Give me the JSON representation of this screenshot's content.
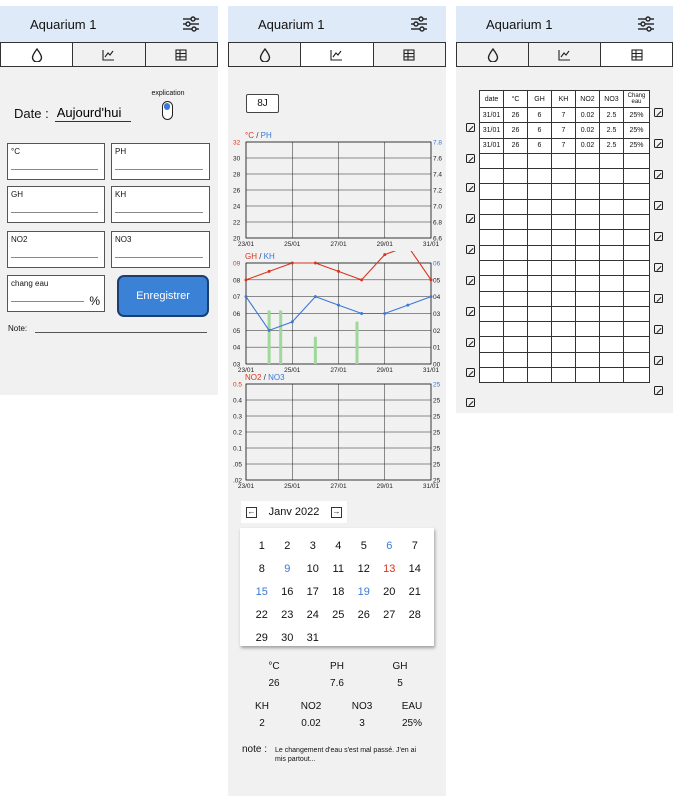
{
  "app": {
    "title": "Aquarium 1"
  },
  "screen1": {
    "date_label": "Date :",
    "date_value": "Aujourd'hui",
    "explication_label": "explication",
    "fields": [
      {
        "label": "°C"
      },
      {
        "label": "PH"
      },
      {
        "label": "GH"
      },
      {
        "label": "KH"
      },
      {
        "label": "NO2"
      },
      {
        "label": "NO3"
      }
    ],
    "water_change_label": "chang eau",
    "water_change_unit": "%",
    "save_label": "Enregistrer",
    "note_label": "Note:"
  },
  "screen2": {
    "range_label": "8J",
    "chart_data": [
      {
        "type": "line",
        "title_left": "°C",
        "title_sep": " / ",
        "title_right": "PH",
        "x": [
          "23/01",
          "25/01",
          "27/01",
          "29/01",
          "31/01"
        ],
        "y_left_ticks": [
          "32",
          "30",
          "28",
          "26",
          "24",
          "22",
          "20"
        ],
        "y_right_ticks": [
          "7.8",
          "7.6",
          "7.4",
          "7.2",
          "7.0",
          "6.8",
          "6.6"
        ],
        "series": []
      },
      {
        "type": "line",
        "title_left": "GH",
        "title_sep": " / ",
        "title_right": "KH",
        "x": [
          "23/01",
          "25/01",
          "27/01",
          "29/01",
          "31/01"
        ],
        "y_left_ticks": [
          "09",
          "08",
          "07",
          "06",
          "05",
          "04",
          "03"
        ],
        "y_right_ticks": [
          "06",
          "05",
          "04",
          "03",
          "02",
          "01",
          "00"
        ],
        "series": [
          {
            "color": "#d9341e",
            "axis": "left",
            "values": [
              5,
              5.5,
              6,
              6,
              5.5,
              5,
              6.5,
              7,
              5
            ]
          },
          {
            "color": "#3b78d8",
            "axis": "right",
            "values": [
              4,
              2,
              2.5,
              4,
              3.5,
              3,
              3,
              3.5,
              4
            ]
          }
        ],
        "bars": [
          {
            "color": "#9fd89a",
            "index": 1,
            "level": 0.53
          },
          {
            "color": "#9fd89a",
            "index": 1.5,
            "level": 0.53
          },
          {
            "color": "#9fd89a",
            "index": 3,
            "level": 0.27
          },
          {
            "color": "#9fd89a",
            "index": 4.8,
            "level": 0.42
          }
        ]
      },
      {
        "type": "line",
        "title_left": "NO2",
        "title_sep": " / ",
        "title_right": "NO3",
        "x": [
          "23/01",
          "25/01",
          "27/01",
          "29/01",
          "31/01"
        ],
        "y_left_ticks": [
          "0.5",
          "0.4",
          "0.3",
          "0.2",
          "0.1",
          ".05",
          ".02"
        ],
        "y_right_ticks": [
          "25",
          "25",
          "25",
          "25",
          "25",
          "25",
          "25"
        ],
        "series": []
      }
    ],
    "calendar": {
      "month_label": "Janv 2022",
      "prev": "←",
      "next": "→",
      "days": [
        {
          "d": "1",
          "c": ""
        },
        {
          "d": "2",
          "c": ""
        },
        {
          "d": "3",
          "c": ""
        },
        {
          "d": "4",
          "c": ""
        },
        {
          "d": "5",
          "c": ""
        },
        {
          "d": "6",
          "c": "blue"
        },
        {
          "d": "7",
          "c": ""
        },
        {
          "d": "8",
          "c": ""
        },
        {
          "d": "9",
          "c": "blue"
        },
        {
          "d": "10",
          "c": ""
        },
        {
          "d": "11",
          "c": ""
        },
        {
          "d": "12",
          "c": ""
        },
        {
          "d": "13",
          "c": "red"
        },
        {
          "d": "14",
          "c": ""
        },
        {
          "d": "15",
          "c": "blue"
        },
        {
          "d": "16",
          "c": ""
        },
        {
          "d": "17",
          "c": ""
        },
        {
          "d": "18",
          "c": ""
        },
        {
          "d": "19",
          "c": "blue"
        },
        {
          "d": "20",
          "c": ""
        },
        {
          "d": "21",
          "c": ""
        },
        {
          "d": "22",
          "c": ""
        },
        {
          "d": "23",
          "c": ""
        },
        {
          "d": "24",
          "c": ""
        },
        {
          "d": "25",
          "c": ""
        },
        {
          "d": "26",
          "c": ""
        },
        {
          "d": "27",
          "c": ""
        },
        {
          "d": "28",
          "c": ""
        },
        {
          "d": "29",
          "c": ""
        },
        {
          "d": "30",
          "c": ""
        },
        {
          "d": "31",
          "c": ""
        }
      ]
    },
    "stats": [
      {
        "name": "°C",
        "value": "26"
      },
      {
        "name": "PH",
        "value": "7.6"
      },
      {
        "name": "GH",
        "value": "5"
      },
      {
        "name": "KH",
        "value": "2"
      },
      {
        "name": "NO2",
        "value": "0.02"
      },
      {
        "name": "NO3",
        "value": "3"
      },
      {
        "name": "EAU",
        "value": "25%"
      }
    ],
    "note_label": "note :",
    "note_text": "Le changement d'eau s'est mal passé. J'en ai mis partout..."
  },
  "screen3": {
    "headers": [
      "date",
      "°C",
      "GH",
      "KH",
      "NO2",
      "NO3",
      "Chang eau"
    ],
    "rows": [
      [
        "31/01",
        "26",
        "6",
        "7",
        "0.02",
        "2.5",
        "25%"
      ],
      [
        "31/01",
        "26",
        "6",
        "7",
        "0.02",
        "2.5",
        "25%"
      ],
      [
        "31/01",
        "26",
        "6",
        "7",
        "0.02",
        "2.5",
        "25%"
      ]
    ],
    "empty_rows": 15
  },
  "colors": {
    "appbar": "#dfeaf8",
    "accent": "#3b82d6",
    "red": "#d9341e",
    "blue": "#3b78d8",
    "green": "#9fd89a"
  },
  "icons": [
    "settings-sliders-icon",
    "water-drop-icon",
    "chart-icon",
    "table-icon",
    "edit-icon",
    "arrow-left-icon",
    "arrow-right-icon"
  ]
}
